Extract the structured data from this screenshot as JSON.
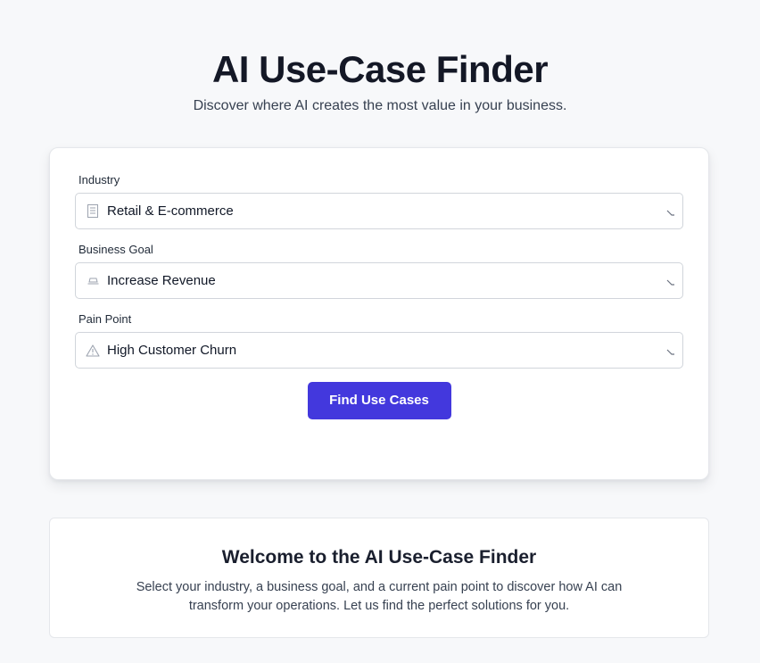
{
  "header": {
    "title": "AI Use-Case Finder",
    "subtitle": "Discover where AI creates the most value in your business."
  },
  "form": {
    "industry": {
      "label": "Industry",
      "value": "Retail & E-commerce",
      "icon": "building-icon"
    },
    "goal": {
      "label": "Business Goal",
      "value": "Increase Revenue",
      "icon": "goal-icon"
    },
    "pain": {
      "label": "Pain Point",
      "value": "High Customer Churn",
      "icon": "warning-icon"
    },
    "submit_label": "Find Use Cases",
    "accent_color": "#4338dd"
  },
  "welcome": {
    "title": "Welcome to the AI Use-Case Finder",
    "body": "Select your industry, a business goal, and a current pain point to discover how AI can transform your operations. Let us find the perfect solutions for you."
  }
}
